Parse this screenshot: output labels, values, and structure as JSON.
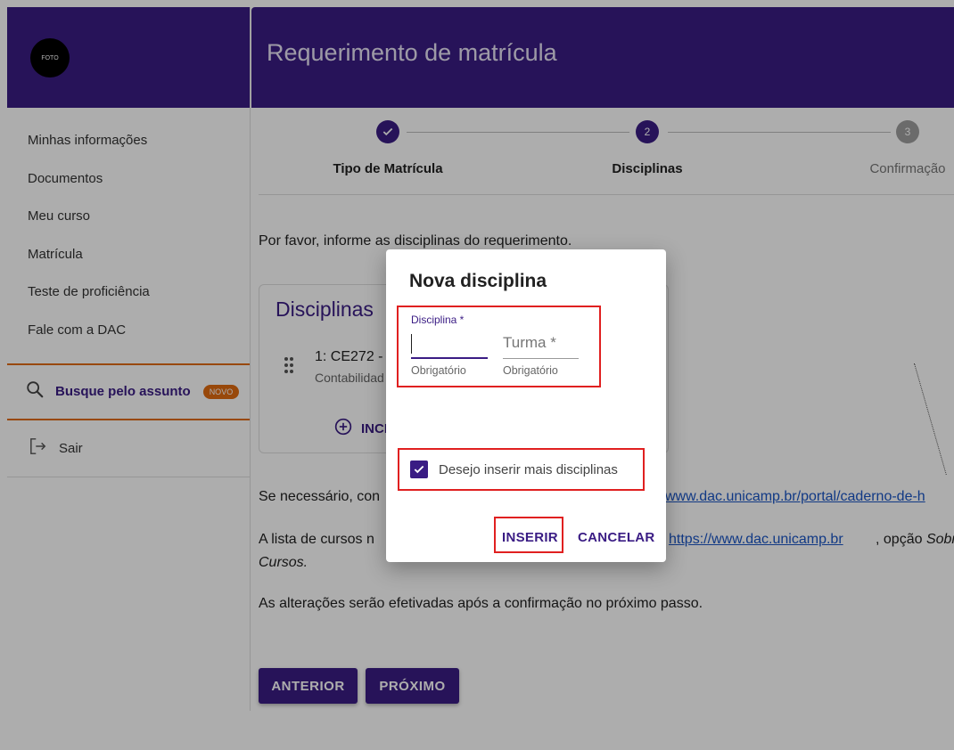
{
  "sidebar": {
    "avatar_text": "FOTO",
    "items": [
      {
        "label": "Minhas informações"
      },
      {
        "label": "Documentos"
      },
      {
        "label": "Meu curso"
      },
      {
        "label": "Matrícula"
      },
      {
        "label": "Teste de proficiência"
      },
      {
        "label": "Fale com a DAC"
      }
    ],
    "search_label": "Busque pelo assunto",
    "search_badge": "NOVO",
    "logout_label": "Sair"
  },
  "header": {
    "title": "Requerimento de matrícula"
  },
  "stepper": {
    "steps": [
      {
        "label": "Tipo de Matrícula",
        "state": "done",
        "number": ""
      },
      {
        "label": "Disciplinas",
        "state": "active",
        "number": "2"
      },
      {
        "label": "Confirmação",
        "state": "pending",
        "number": "3"
      }
    ]
  },
  "content": {
    "intro": "Por favor, informe as disciplinas do requerimento.",
    "card_title": "Disciplinas",
    "item_code": "1: CE272 -",
    "item_name": "Contabilidad",
    "include_label": "INCI",
    "p1_start": "Se necessário, con",
    "p1_link": "www.dac.unicamp.br/portal/caderno-de-h",
    "p2_start": "A lista de cursos n",
    "p2_link": "https://www.dac.unicamp.br",
    "p2_tail_plain": ", opção ",
    "p2_tail_italic": "Sobre",
    "p2_cont": "Cursos.",
    "p3": "As alterações serão efetivadas após a confirmação no próximo passo."
  },
  "footer": {
    "prev_label": "ANTERIOR",
    "next_label": "PRÓXIMO"
  },
  "dialog": {
    "title": "Nova disciplina",
    "disciplina_label": "Disciplina *",
    "disciplina_value": "",
    "disciplina_hint": "Obrigatório",
    "turma_label": "Turma *",
    "turma_hint": "Obrigatório",
    "checkbox_label": "Desejo inserir mais disciplinas",
    "checkbox_checked": true,
    "insert_label": "INSERIR",
    "cancel_label": "CANCELAR"
  },
  "colors": {
    "primary": "#3a1c84",
    "accent": "#e06a10",
    "highlight": "#e02020",
    "link": "#1a55c4"
  }
}
